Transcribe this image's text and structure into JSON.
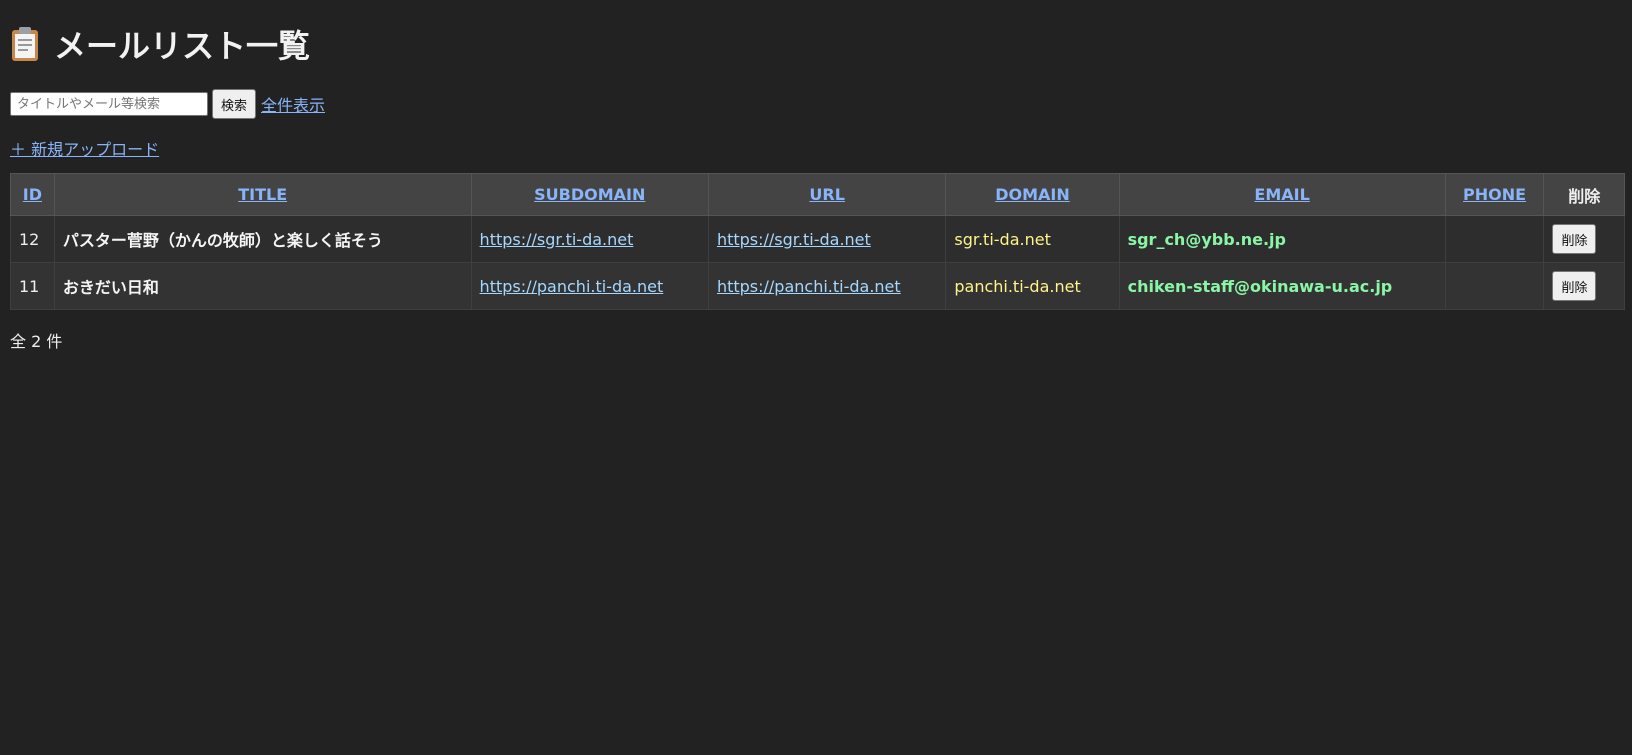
{
  "header": {
    "title": "メールリスト一覧",
    "icon": "clipboard-icon"
  },
  "search": {
    "placeholder": "タイトルやメール等検索",
    "button_label": "検索",
    "show_all_label": "全件表示"
  },
  "upload": {
    "label": "＋ 新規アップロード"
  },
  "table": {
    "columns": [
      "ID",
      "TITLE",
      "SUBDOMAIN",
      "URL",
      "DOMAIN",
      "EMAIL",
      "PHONE",
      "削除"
    ],
    "rows": [
      {
        "id": "12",
        "title": "パスター菅野（かんの牧師）と楽しく話そう",
        "subdomain": "https://sgr.ti-da.net",
        "url": "https://sgr.ti-da.net",
        "domain": "sgr.ti-da.net",
        "email": "sgr_ch@ybb.ne.jp",
        "phone": "",
        "delete_label": "削除"
      },
      {
        "id": "11",
        "title": "おきだい日和",
        "subdomain": "https://panchi.ti-da.net",
        "url": "https://panchi.ti-da.net",
        "domain": "panchi.ti-da.net",
        "email": "chiken-staff@okinawa-u.ac.jp",
        "phone": "",
        "delete_label": "削除"
      }
    ]
  },
  "footer": {
    "total": "全 2 件"
  },
  "colors": {
    "background": "#222222",
    "link": "#8ab4f8",
    "url_link": "#a6d8ff",
    "domain_text": "#fff38a",
    "email_text": "#8af5a6",
    "header_bg": "#444444"
  }
}
